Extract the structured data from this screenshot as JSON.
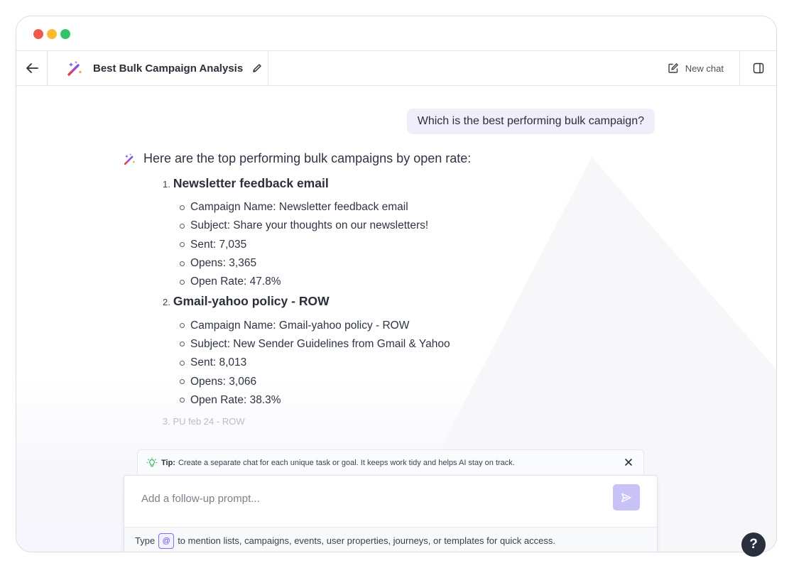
{
  "header": {
    "title": "Best Bulk Campaign Analysis",
    "new_chat_label": "New chat"
  },
  "user_message": "Which is the best performing bulk campaign?",
  "response": {
    "intro": "Here are the top performing bulk campaigns by open rate:",
    "campaigns": [
      {
        "number": "1.",
        "title": "Newsletter feedback email",
        "details": [
          "Campaign Name: Newsletter feedback email",
          "Subject: Share your thoughts on our newsletters!",
          "Sent: 7,035",
          "Opens: 3,365",
          "Open Rate: 47.8%"
        ]
      },
      {
        "number": "2.",
        "title": "Gmail-yahoo policy - ROW",
        "details": [
          "Campaign Name: Gmail-yahoo policy - ROW",
          "Subject: New Sender Guidelines from Gmail & Yahoo",
          "Sent: 8,013",
          "Opens: 3,066",
          "Open Rate: 38.3%"
        ]
      }
    ],
    "truncated_item": "3. PU feb 24 - ROW"
  },
  "tip": {
    "label": "Tip:",
    "text": "Create a separate chat for each unique task or goal. It keeps work tidy and helps AI stay on track."
  },
  "composer": {
    "placeholder": "Add a follow-up prompt...",
    "footer_before": "Type",
    "mention_symbol": "@",
    "footer_after": "to mention lists, campaigns, events, user properties, journeys, or templates for quick access."
  },
  "help_label": "?",
  "colors": {
    "accent": "#7c6ff0",
    "send_button": "#c9c2f7",
    "user_bubble": "#f0eefb"
  }
}
